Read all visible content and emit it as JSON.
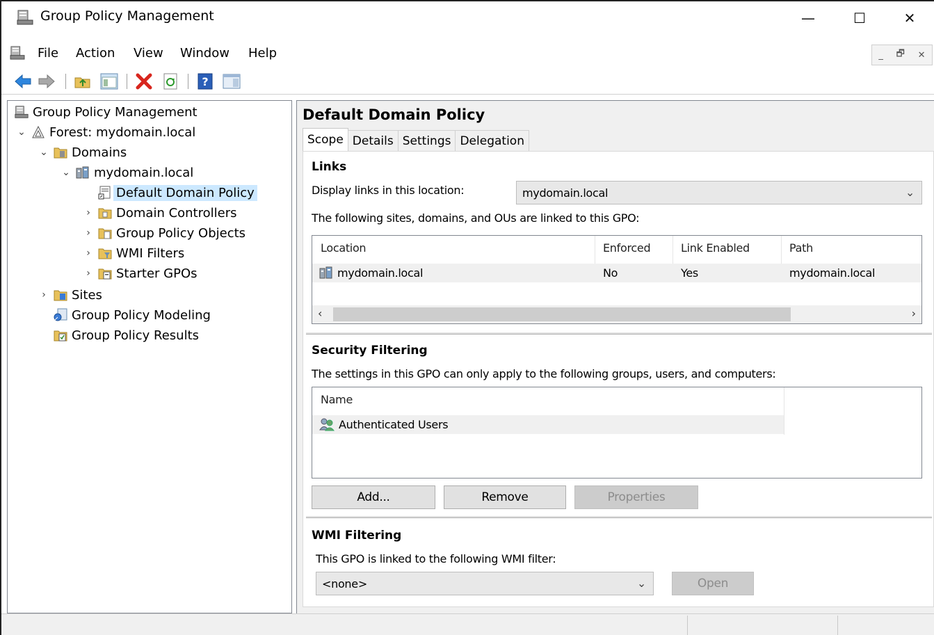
{
  "window": {
    "title": "Group Policy Management",
    "controls": {
      "minimize": "—",
      "maximize": "☐",
      "close": "✕"
    }
  },
  "menu": {
    "items": [
      "File",
      "Action",
      "View",
      "Window",
      "Help"
    ],
    "mdi_controls": {
      "minimize": "_",
      "restore": "🗗",
      "close": "✕"
    }
  },
  "toolbar": {
    "icons": [
      "back-arrow-icon",
      "forward-arrow-icon",
      "up-folder-icon",
      "show-hide-tree-icon",
      "delete-icon",
      "refresh-icon",
      "help-icon",
      "action-pane-icon"
    ]
  },
  "tree": {
    "root": "Group Policy Management",
    "forest": "Forest: mydomain.local",
    "domains": "Domains",
    "domain": "mydomain.local",
    "default_policy": "Default Domain Policy",
    "domain_controllers": "Domain Controllers",
    "gpo_objects": "Group Policy Objects",
    "wmi_filters": "WMI Filters",
    "starter_gpos": "Starter GPOs",
    "sites": "Sites",
    "modeling": "Group Policy Modeling",
    "results": "Group Policy Results"
  },
  "details": {
    "title": "Default Domain Policy",
    "tabs": [
      "Scope",
      "Details",
      "Settings",
      "Delegation"
    ],
    "active_tab": "Scope",
    "links": {
      "heading": "Links",
      "display_label": "Display links in this location:",
      "location_value": "mydomain.local",
      "linked_text": "The following sites, domains, and OUs are linked to this GPO:",
      "columns": [
        "Location",
        "Enforced",
        "Link Enabled",
        "Path"
      ],
      "rows": [
        {
          "location": "mydomain.local",
          "enforced": "No",
          "link_enabled": "Yes",
          "path": "mydomain.local"
        }
      ]
    },
    "security": {
      "heading": "Security Filtering",
      "description": "The settings in this GPO can only apply to the following groups, users, and computers:",
      "column": "Name",
      "rows": [
        "Authenticated Users"
      ],
      "buttons": {
        "add": "Add...",
        "remove": "Remove",
        "properties": "Properties"
      }
    },
    "wmi": {
      "heading": "WMI Filtering",
      "description": "This GPO is linked to the following WMI filter:",
      "filter_value": "<none>",
      "open_button": "Open"
    }
  }
}
